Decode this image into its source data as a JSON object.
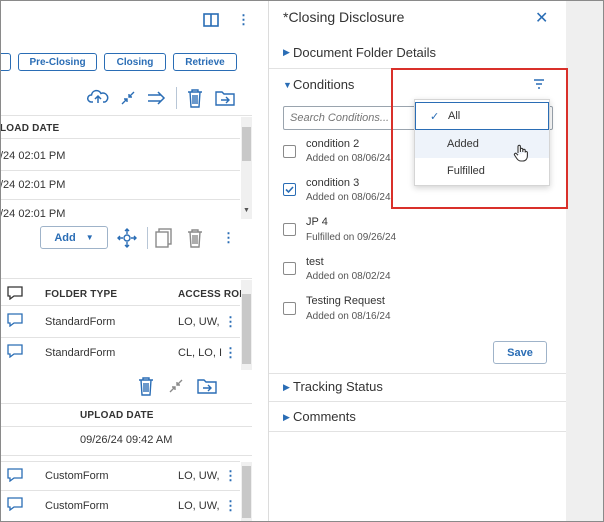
{
  "left": {
    "tabs": [
      "Pre-Closing",
      "Closing",
      "Retrieve"
    ],
    "upper_table": {
      "header": "LOAD DATE",
      "rows": [
        "/24 02:01 PM",
        "/24 02:01 PM",
        "/24 02:01 PM"
      ]
    },
    "add_button": "Add",
    "docs_table": {
      "headers": [
        "FOLDER TYPE",
        "ACCESS ROLI"
      ],
      "rows": [
        {
          "type": "StandardForm",
          "access": "LO, UW,"
        },
        {
          "type": "StandardForm",
          "access": "CL, LO, I"
        }
      ]
    },
    "upload_table": {
      "header": "UPLOAD DATE",
      "value": "09/26/24 09:42 AM"
    },
    "docs_table2": {
      "rows": [
        {
          "type": "CustomForm",
          "access": "LO, UW,"
        },
        {
          "type": "CustomForm",
          "access": "LO, UW,"
        }
      ]
    }
  },
  "panel": {
    "title": "*Closing Disclosure",
    "sections": {
      "folder_details": "Document Folder Details",
      "conditions": "Conditions",
      "tracking": "Tracking Status",
      "comments": "Comments"
    },
    "search_placeholder": "Search Conditions...",
    "conditions": [
      {
        "name": "condition 2",
        "date": "Added on 08/06/24",
        "checked": false
      },
      {
        "name": "condition 3",
        "date": "Added on 08/06/24",
        "checked": true
      },
      {
        "name": "JP 4",
        "date": "Fulfilled on 09/26/24",
        "checked": false
      },
      {
        "name": "test",
        "date": "Added on 08/02/24",
        "checked": false
      },
      {
        "name": "Testing Request",
        "date": "Added on 08/16/24",
        "checked": false
      }
    ],
    "save_label": "Save",
    "filter_options": [
      "All",
      "Added",
      "Fulfilled"
    ],
    "filter_selected": "All"
  },
  "colors": {
    "accent": "#2a6db5",
    "highlight": "#d9302a"
  },
  "icons": [
    "columns-icon",
    "kebab-icon",
    "cloud-upload-icon",
    "collapse-icon",
    "send-icon",
    "trash-icon",
    "folder-move-icon",
    "move-icon",
    "copy-icon",
    "chat-icon",
    "close-icon",
    "filter-icon",
    "check-icon",
    "hand-cursor-icon"
  ]
}
